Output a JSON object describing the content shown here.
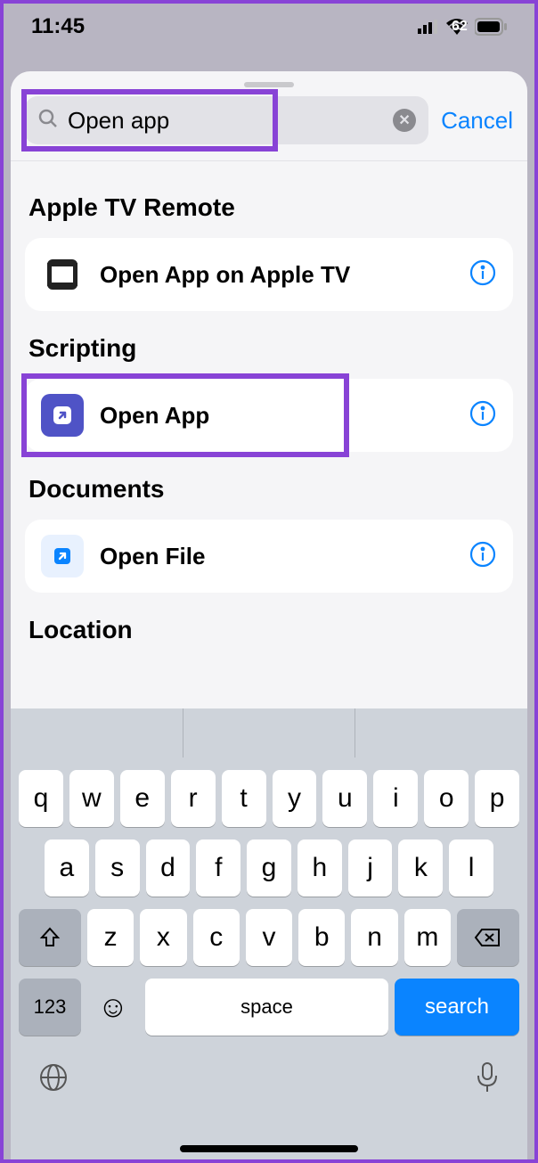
{
  "status": {
    "time": "11:45",
    "battery": "62"
  },
  "search": {
    "value": "Open app",
    "cancel": "Cancel"
  },
  "sections": {
    "s0": {
      "title": "Apple TV Remote",
      "item": "Open App on Apple TV"
    },
    "s1": {
      "title": "Scripting",
      "item": "Open App"
    },
    "s2": {
      "title": "Documents",
      "item": "Open File"
    },
    "s3": {
      "title": "Location"
    }
  },
  "keyboard": {
    "row1": {
      "k0": "q",
      "k1": "w",
      "k2": "e",
      "k3": "r",
      "k4": "t",
      "k5": "y",
      "k6": "u",
      "k7": "i",
      "k8": "o",
      "k9": "p"
    },
    "row2": {
      "k0": "a",
      "k1": "s",
      "k2": "d",
      "k3": "f",
      "k4": "g",
      "k5": "h",
      "k6": "j",
      "k7": "k",
      "k8": "l"
    },
    "row3": {
      "k0": "z",
      "k1": "x",
      "k2": "c",
      "k3": "v",
      "k4": "b",
      "k5": "n",
      "k6": "m"
    },
    "numbers": "123",
    "space": "space",
    "search": "search"
  }
}
